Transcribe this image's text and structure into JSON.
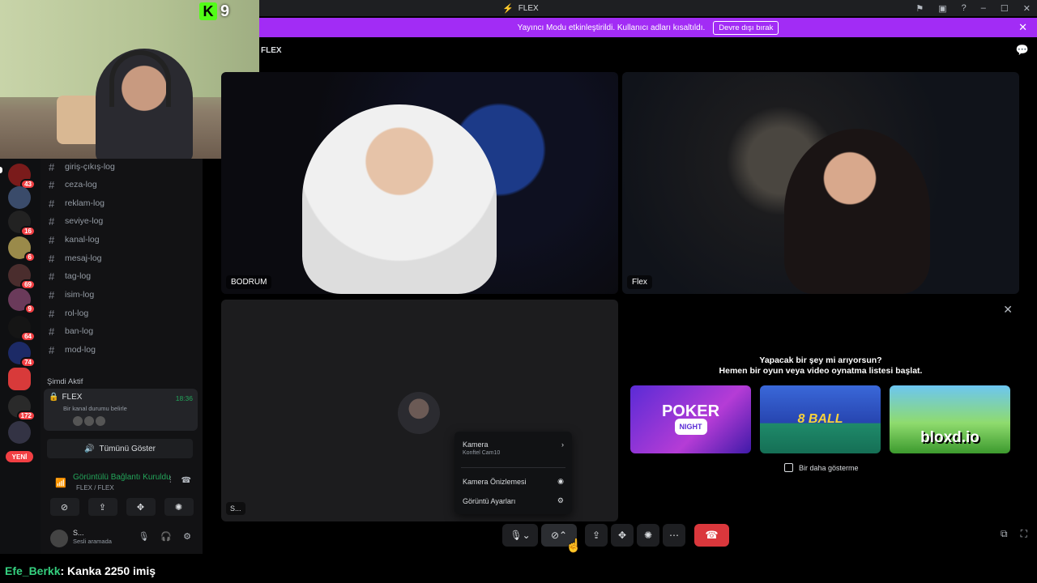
{
  "webcam": {
    "kick_count": "9",
    "kick_logo": "K"
  },
  "titlebar": {
    "title": "FLEX"
  },
  "banner": {
    "message": "Yayıncı Modu etkinleştirildi. Kullanıcı adları kısaltıldı.",
    "disable_label": "Devre dışı bırak"
  },
  "servers": [
    {
      "icon": "server-underworld",
      "badge": "43",
      "color": "#7a1b1b"
    },
    {
      "icon": "server-2",
      "badge": "",
      "color": "#3a4b6a"
    },
    {
      "icon": "server-3",
      "badge": "16",
      "color": "#222222"
    },
    {
      "icon": "server-4",
      "badge": "6",
      "color": "#9a8a4a"
    },
    {
      "icon": "server-5",
      "badge": "69",
      "color": "#4a2d2d"
    },
    {
      "icon": "server-6",
      "badge": "9",
      "color": "#6a3a5a"
    },
    {
      "icon": "server-7",
      "badge": "64",
      "color": "#151515"
    },
    {
      "icon": "server-8",
      "badge": "74",
      "color": "#1c2a66"
    },
    {
      "icon": "server-9",
      "badge": "",
      "color": "#d83a3a"
    },
    {
      "icon": "server-10",
      "badge": "172",
      "color": "#2a2a2a"
    },
    {
      "icon": "server-11",
      "badge": "",
      "color": "#333344"
    }
  ],
  "new_badge": "YENİ",
  "channels": [
    "giriş-çıkış-log",
    "ceza-log",
    "reklam-log",
    "seviye-log",
    "kanal-log",
    "mesaj-log",
    "tag-log",
    "isim-log",
    "rol-log",
    "ban-log",
    "mod-log"
  ],
  "now_active": "Şimdi Aktif",
  "voice_card": {
    "title": "FLEX",
    "time": "18:36",
    "status": "Bir kanal durumu belirle"
  },
  "show_all": "Tümünü Göster",
  "connection": {
    "title": "Görüntülü Bağlantı Kuruldu",
    "subtitle": "FLEX / FLEX"
  },
  "user": {
    "name": "S...",
    "status": "Sesli aramada"
  },
  "call": {
    "header": "FLEX"
  },
  "tiles": {
    "bodrum": "BODRUM",
    "flex": "Flex",
    "empty": "S..."
  },
  "camera_menu": {
    "camera_label": "Kamera",
    "camera_device": "Konftel Cam10",
    "preview_label": "Kamera Önizlemesi",
    "settings_label": "Görüntü Ayarları"
  },
  "activity": {
    "heading_line1": "Yapacak bir şey mi arıyorsun?",
    "heading_line2": "Hemen bir oyun veya video oynatma listesi başlat.",
    "games": [
      {
        "title": "POKER",
        "subtitle": "NIGHT"
      },
      {
        "title": "8 BALL"
      },
      {
        "title": "bloxd.io"
      }
    ],
    "dont_show": "Bir daha gösterme"
  },
  "chat": {
    "user": "Efe_Berkk",
    "message": ": Kanka 2250 imiş"
  }
}
